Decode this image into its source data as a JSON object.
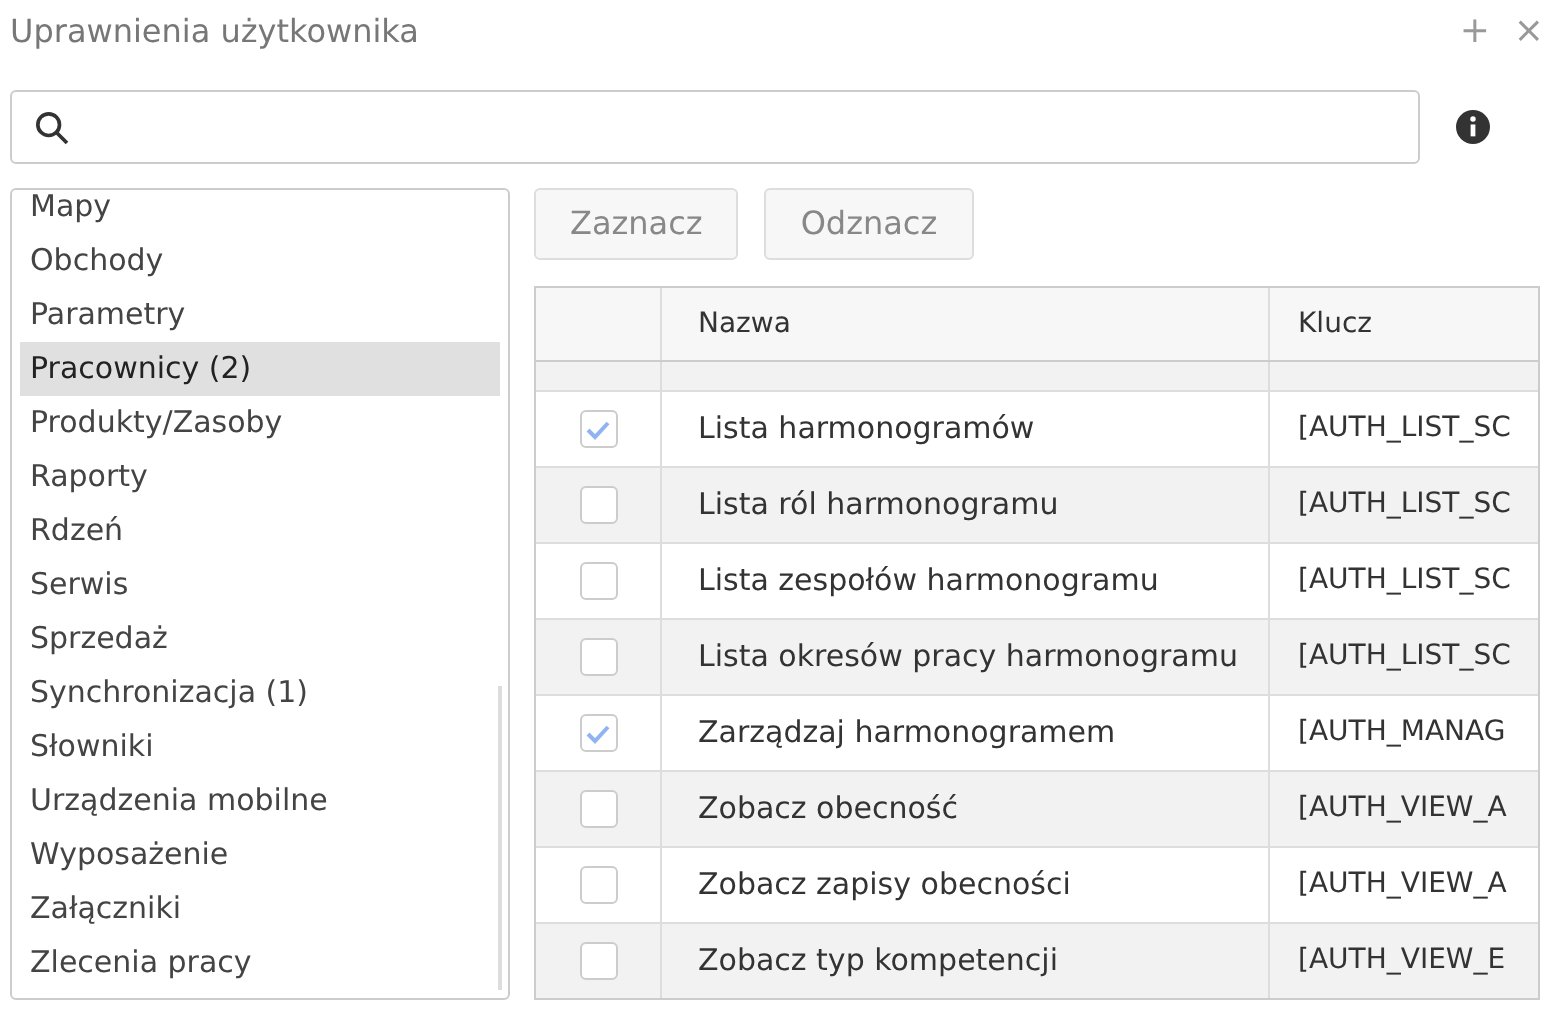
{
  "window": {
    "title": "Uprawnienia użytkownika",
    "buttons": [
      "+",
      "×"
    ]
  },
  "categories": [
    {
      "label": "Mapy",
      "selected": false
    },
    {
      "label": "Obchody",
      "selected": false
    },
    {
      "label": "Parametry",
      "selected": false
    },
    {
      "label": "Pracownicy (2)",
      "selected": true
    },
    {
      "label": "Produkty/Zasoby",
      "selected": false
    },
    {
      "label": "Raporty",
      "selected": false
    },
    {
      "label": "Rdzeń",
      "selected": false
    },
    {
      "label": "Serwis",
      "selected": false
    },
    {
      "label": "Sprzedaż",
      "selected": false
    },
    {
      "label": "Synchronizacja (1)",
      "selected": false
    },
    {
      "label": "Słowniki",
      "selected": false
    },
    {
      "label": "Urządzenia mobilne",
      "selected": false
    },
    {
      "label": "Wyposażenie",
      "selected": false
    },
    {
      "label": "Załączniki",
      "selected": false
    },
    {
      "label": "Zlecenia pracy",
      "selected": false
    }
  ],
  "actions": [
    "Zaznacz",
    "Odznacz"
  ],
  "table": {
    "columns": [
      "Nazwa",
      "Klucz"
    ],
    "rows": [
      {
        "checked": true,
        "name": "Lista harmonogramów",
        "key": "[AUTH_LIST_SC"
      },
      {
        "checked": false,
        "name": "Lista ról harmonogramu",
        "key": "[AUTH_LIST_SC"
      },
      {
        "checked": false,
        "name": "Lista zespołów harmonogramu",
        "key": "[AUTH_LIST_SC"
      },
      {
        "checked": false,
        "name": "Lista okresów pracy harmonogramu",
        "key": "[AUTH_LIST_SC"
      },
      {
        "checked": true,
        "name": "Zarządzaj harmonogramem",
        "key": "[AUTH_MANAG"
      },
      {
        "checked": false,
        "name": "Zobacz obecność",
        "key": "[AUTH_VIEW_A"
      },
      {
        "checked": false,
        "name": "Zobacz zapisy obecności",
        "key": "[AUTH_VIEW_A"
      },
      {
        "checked": false,
        "name": "Zobacz typ kompetencji",
        "key": "[AUTH_VIEW_E"
      }
    ]
  }
}
